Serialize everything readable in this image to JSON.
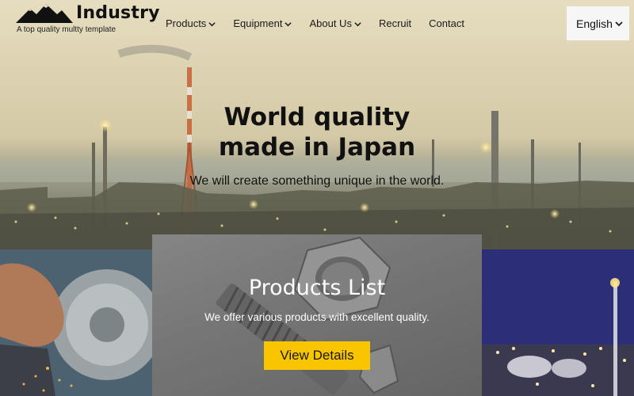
{
  "brand": {
    "name": "Industry",
    "tagline": "A top quality multty template",
    "logo_icon": "mountain-icon"
  },
  "nav": {
    "items": [
      {
        "label": "Products",
        "has_dropdown": true
      },
      {
        "label": "Equipment",
        "has_dropdown": true
      },
      {
        "label": "About Us",
        "has_dropdown": true
      },
      {
        "label": "Recruit",
        "has_dropdown": false
      },
      {
        "label": "Contact",
        "has_dropdown": false
      }
    ]
  },
  "language": {
    "selected": "English"
  },
  "hero": {
    "title_line1": "World quality",
    "title_line2": "made in Japan",
    "subtitle": "We will create something unique in the world."
  },
  "products": {
    "title": "Products List",
    "subtitle": "We offer various products with excellent quality.",
    "button_label": "View Details"
  },
  "colors": {
    "accent": "#f8c500",
    "text_dark": "#111111",
    "lang_bg": "#f6f6f6"
  }
}
